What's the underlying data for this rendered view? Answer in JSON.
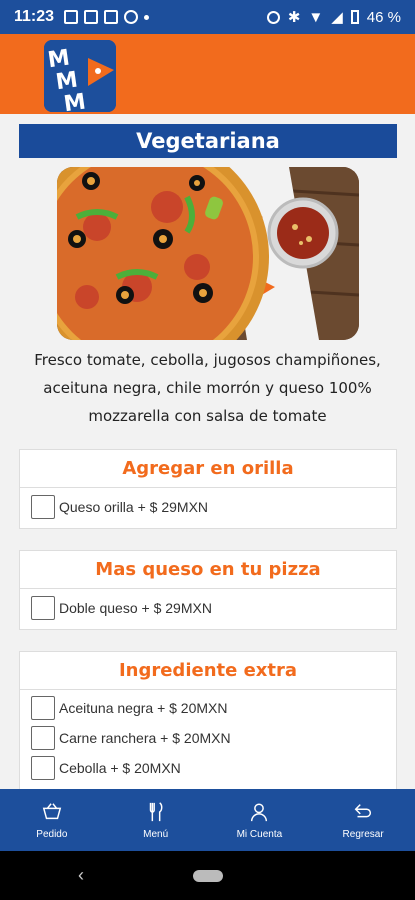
{
  "status": {
    "time": "11:23",
    "battery": "46 %"
  },
  "app": {
    "logo_letters": "MMM"
  },
  "product": {
    "name": "Vegetariana",
    "description": "Fresco tomate, cebolla, jugosos champiñones, aceituna negra, chile morrón y queso 100% mozzarella con salsa de tomate"
  },
  "sections": [
    {
      "title": "Agregar en orilla",
      "options": [
        "Queso orilla + $ 29MXN"
      ]
    },
    {
      "title": "Mas queso en tu pizza",
      "options": [
        "Doble queso + $ 29MXN"
      ]
    },
    {
      "title": "Ingrediente extra",
      "options": [
        "Aceituna negra + $ 20MXN",
        "Carne ranchera + $ 20MXN",
        "Cebolla + $ 20MXN"
      ]
    }
  ],
  "nav": [
    {
      "label": "Pedido",
      "icon": "basket-icon"
    },
    {
      "label": "Menú",
      "icon": "fork-knife-icon"
    },
    {
      "label": "Mi Cuenta",
      "icon": "user-icon"
    },
    {
      "label": "Regresar",
      "icon": "return-arrow-icon"
    }
  ],
  "colors": {
    "primary": "#1d4f9c",
    "accent": "#f26b1d"
  }
}
